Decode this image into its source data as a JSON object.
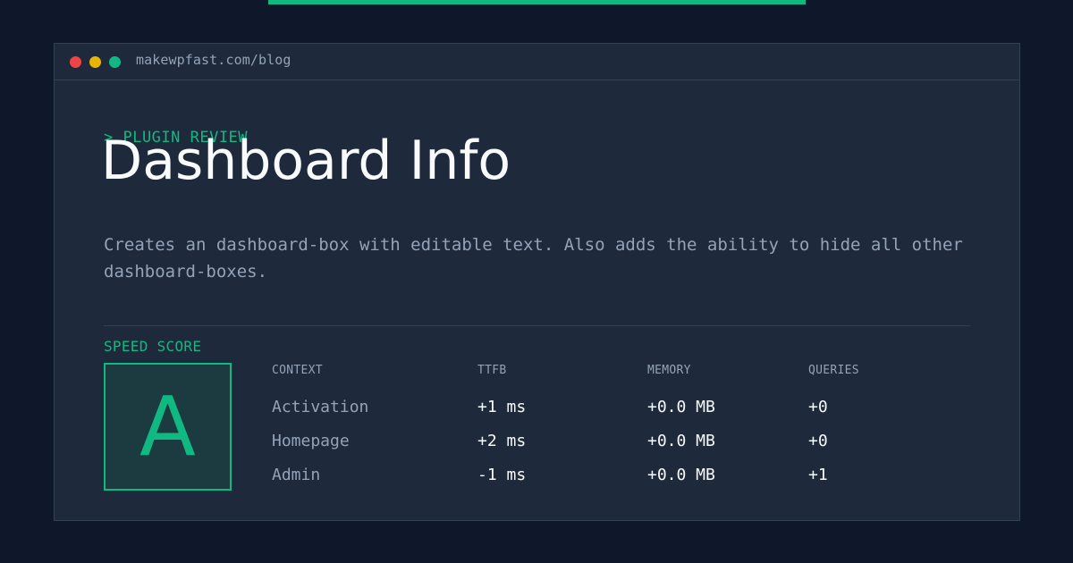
{
  "window": {
    "url": "makewpfast.com/blog"
  },
  "header": {
    "kicker": "> PLUGIN REVIEW",
    "title": "Dashboard Info"
  },
  "description": "Creates an dashboard-box with editable text. Also adds the ability to hide all other dashboard-boxes.",
  "score": {
    "label": "SPEED SCORE",
    "grade": "A"
  },
  "table": {
    "columns": [
      "CONTEXT",
      "TTFB",
      "MEMORY",
      "QUERIES"
    ],
    "rows": [
      {
        "context": "Activation",
        "ttfb": "+1 ms",
        "memory": "+0.0 MB",
        "queries": "+0"
      },
      {
        "context": "Homepage",
        "ttfb": "+2 ms",
        "memory": "+0.0 MB",
        "queries": "+0"
      },
      {
        "context": "Admin",
        "ttfb": "-1 ms",
        "memory": "+0.0 MB",
        "queries": "+1"
      }
    ]
  },
  "colors": {
    "background": "#0f172a",
    "panel": "#1e293b",
    "accent": "#10b981",
    "muted_text": "#94a3b8",
    "text": "#f8fafc",
    "dot_red": "#ef4444",
    "dot_yellow": "#eab308",
    "dot_green": "#10b981"
  }
}
